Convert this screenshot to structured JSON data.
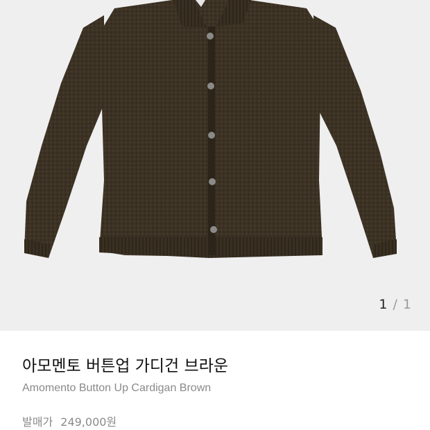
{
  "gallery": {
    "image_alt": "brown button-up cardigan product photo",
    "current": "1",
    "separator": "/",
    "total": "1",
    "background": "#efefef"
  },
  "product": {
    "title_ko": "아모멘토 버튼업 가디건 브라운",
    "title_en": "Amomento Button Up Cardigan Brown",
    "price_label": "발매가",
    "price": "249,000원",
    "garment_color": "#3c3224"
  }
}
